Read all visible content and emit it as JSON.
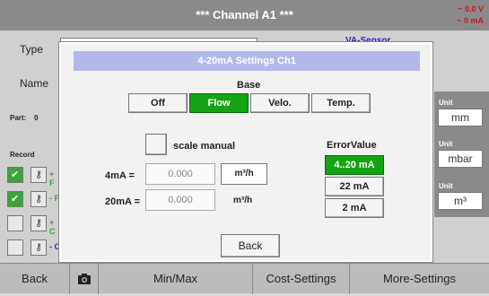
{
  "titlebar": {
    "title": "*** Channel A1 ***",
    "status_voltage": "~ 0.0 V",
    "status_current": "~ 0 mA"
  },
  "background": {
    "type_label": "Type",
    "name_label": "Name",
    "sensor_label": "VA-Sensor",
    "part_label": "Part:",
    "part_value": "0",
    "record_label": "Record",
    "record_rows": [
      {
        "checked": true,
        "suffix": "+ F"
      },
      {
        "checked": true,
        "suffix": "- F"
      },
      {
        "checked": false,
        "suffix": "+ C"
      },
      {
        "checked": false,
        "suffix": "- C"
      }
    ],
    "unit_label": "Unit",
    "units": [
      "mm",
      "mbar",
      "m³"
    ]
  },
  "dialog": {
    "title": "4-20mA Settings Ch1",
    "base_label": "Base",
    "base_options": [
      "Off",
      "Flow",
      "Velo.",
      "Temp."
    ],
    "base_selected": "Flow",
    "scale_manual_label": "scale manual",
    "four_ma_label": "4mA =",
    "four_ma_value": "0.000",
    "four_ma_unit": "m³/h",
    "twenty_ma_label": "20mA =",
    "twenty_ma_value": "0.000",
    "twenty_ma_unit": "m³/h",
    "error_value_label": "ErrorValue",
    "error_options": [
      "4..20 mA",
      "22 mA",
      "2 mA"
    ],
    "error_selected": "4..20 mA",
    "back_label": "Back"
  },
  "bottombar": {
    "back": "Back",
    "camera_icon": "camera-icon",
    "min_max": "Min/Max",
    "cost_settings": "Cost-Settings",
    "more_settings": "More-Settings"
  }
}
